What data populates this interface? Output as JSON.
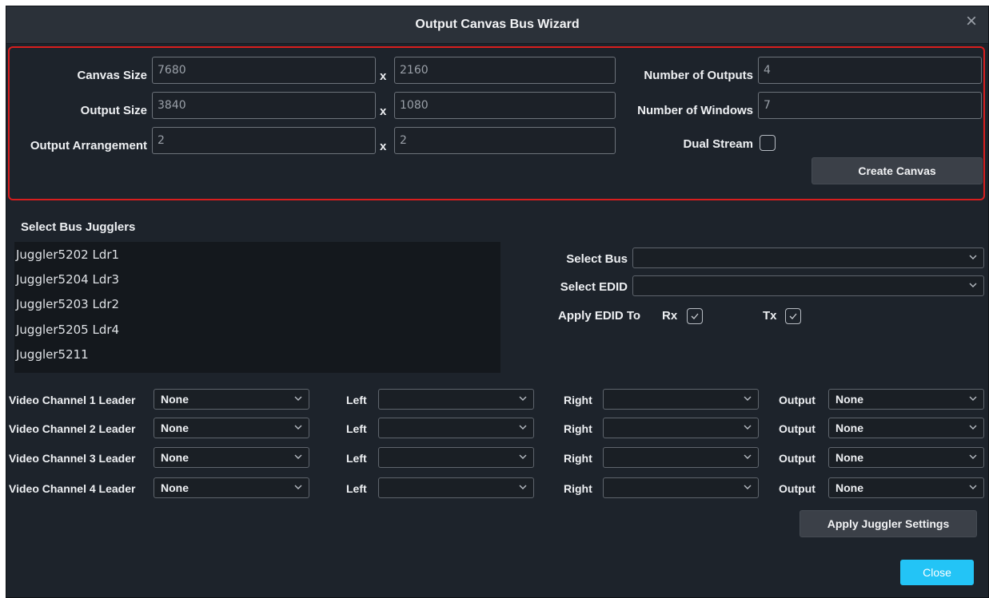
{
  "window": {
    "title": "Output Canvas Bus Wizard",
    "close_icon": "close-icon"
  },
  "canvas": {
    "canvas_size_label": "Canvas Size",
    "canvas_width": "7680",
    "canvas_height": "2160",
    "output_size_label": "Output Size",
    "output_width": "3840",
    "output_height": "1080",
    "arrangement_label": "Output Arrangement",
    "arrangement_cols": "2",
    "arrangement_rows": "2",
    "separator": "x",
    "num_outputs_label": "Number of Outputs",
    "num_outputs": "4",
    "num_windows_label": "Number of Windows",
    "num_windows": "7",
    "dual_stream_label": "Dual Stream",
    "dual_stream_checked": false,
    "create_button": "Create Canvas"
  },
  "jugglers": {
    "heading": "Select Bus Jugglers",
    "items": [
      "Juggler5202 Ldr1",
      "Juggler5204 Ldr3",
      "Juggler5203 Ldr2",
      "Juggler5205 Ldr4",
      "Juggler5211"
    ]
  },
  "bus": {
    "select_bus_label": "Select Bus",
    "select_bus_value": "",
    "select_edid_label": "Select EDID",
    "select_edid_value": "",
    "apply_edid_label": "Apply EDID To",
    "rx_label": "Rx",
    "rx_checked": true,
    "tx_label": "Tx",
    "tx_checked": true
  },
  "channels": [
    {
      "label": "Video Channel 1 Leader",
      "leader": "None",
      "left_label": "Left",
      "left": "",
      "right_label": "Right",
      "right": "",
      "output_label": "Output",
      "output": "None"
    },
    {
      "label": "Video Channel 2 Leader",
      "leader": "None",
      "left_label": "Left",
      "left": "",
      "right_label": "Right",
      "right": "",
      "output_label": "Output",
      "output": "None"
    },
    {
      "label": "Video Channel 3 Leader",
      "leader": "None",
      "left_label": "Left",
      "left": "",
      "right_label": "Right",
      "right": "",
      "output_label": "Output",
      "output": "None"
    },
    {
      "label": "Video Channel 4 Leader",
      "leader": "None",
      "left_label": "Left",
      "left": "",
      "right_label": "Right",
      "right": "",
      "output_label": "Output",
      "output": "None"
    }
  ],
  "footer": {
    "apply_juggler_button": "Apply Juggler Settings",
    "close_button": "Close"
  },
  "colors": {
    "accent": "#23c4f6",
    "highlight_border": "#d81e1e",
    "background": "#1d232b"
  }
}
